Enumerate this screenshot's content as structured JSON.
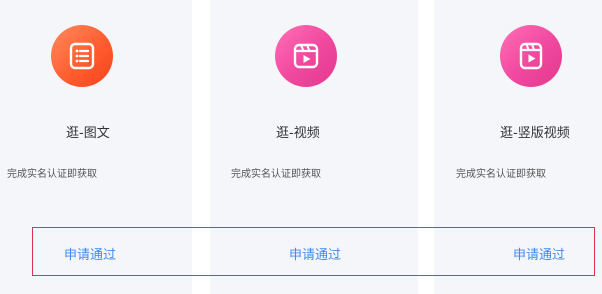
{
  "cards": [
    {
      "title": "逛-图文",
      "description": "完成实名认证即获取",
      "action": "申请通过",
      "icon": "article-list-icon",
      "accent": "#ff5a2c"
    },
    {
      "title": "逛-视频",
      "description": "完成实名认证即获取",
      "action": "申请通过",
      "icon": "video-clapper-icon",
      "accent": "#f0479f"
    },
    {
      "title": "逛-竖版视频",
      "description": "完成实名认证即获取",
      "action": "申请通过",
      "icon": "vertical-video-clapper-icon",
      "accent": "#f0479f"
    }
  ],
  "colors": {
    "card_background": "#f5f6fa",
    "link": "#3d8bf2",
    "highlight_border": "#e0344a"
  }
}
